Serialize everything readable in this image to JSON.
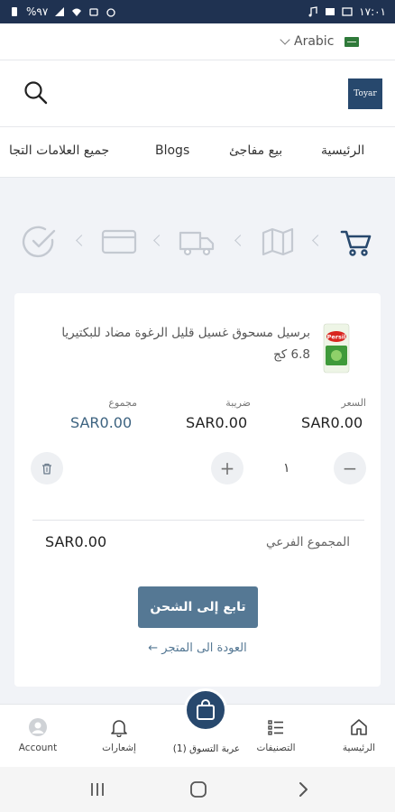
{
  "status_bar": {
    "time": "١٧:٠١",
    "battery": "%٩٧"
  },
  "language": {
    "label": "Arabic",
    "flag_icon": "saudi-flag-icon"
  },
  "header": {
    "logo_text": "Toyar",
    "search_icon": "search-icon"
  },
  "nav": {
    "items": [
      {
        "label": "الرئيسية"
      },
      {
        "label": "بيع مفاجئ"
      },
      {
        "label": "Blogs"
      },
      {
        "label": "جميع العلامات التجا"
      }
    ]
  },
  "checkout_steps": [
    {
      "icon": "cart-icon",
      "active": true
    },
    {
      "icon": "map-icon",
      "active": false
    },
    {
      "icon": "truck-icon",
      "active": false
    },
    {
      "icon": "credit-card-icon",
      "active": false
    },
    {
      "icon": "check-circle-icon",
      "active": false
    }
  ],
  "cart": {
    "product": {
      "name": "برسيل مسحوق غسيل قليل الرغوة مضاد للبكتيريا 6.8 كج",
      "image_label": "Persil"
    },
    "columns": {
      "price_label": "السعر",
      "price_value": "SAR0.00",
      "tax_label": "ضريبة",
      "tax_value": "SAR0.00",
      "total_label": "مجموع",
      "total_value": "SAR0.00"
    },
    "quantity": {
      "minus": "−",
      "value": "١",
      "plus": "+"
    },
    "subtotal_label": "المجموع الفرعي",
    "subtotal_value": "SAR0.00",
    "checkout_button": "تابع إلى الشحن",
    "back_link": "العودة الى المتجر ←"
  },
  "bottom_nav": {
    "home": "الرئيسية",
    "categories": "التصنيفات",
    "cart": "عربة التسوق (1)",
    "notifications": "إشعارات",
    "account": "Account"
  },
  "colors": {
    "primary": "#27486d",
    "button": "#557894",
    "status_bar": "#1f3251"
  }
}
